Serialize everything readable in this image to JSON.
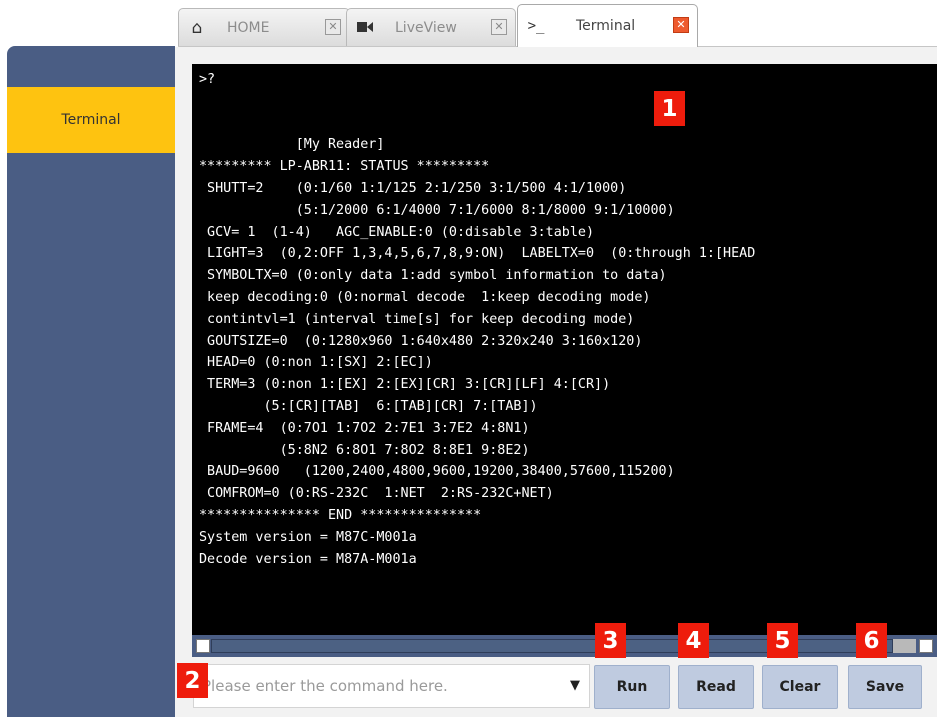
{
  "tabs": [
    {
      "label": "HOME",
      "icon": "home-icon"
    },
    {
      "label": "LiveView",
      "icon": "video-camera-icon"
    },
    {
      "label": "Terminal",
      "icon": "terminal-prompt-icon",
      "prompt_glyph": ">_",
      "active": true
    }
  ],
  "sidebar": {
    "items": [
      {
        "label": "Terminal",
        "active": true
      }
    ]
  },
  "terminal": {
    "lines": [
      ">?",
      "",
      "",
      "            [My Reader]",
      "********* LP-ABR11: STATUS *********",
      " SHUTT=2    (0:1/60 1:1/125 2:1/250 3:1/500 4:1/1000)",
      "            (5:1/2000 6:1/4000 7:1/6000 8:1/8000 9:1/10000)",
      " GCV= 1  (1-4)   AGC_ENABLE:0 (0:disable 3:table)",
      " LIGHT=3  (0,2:OFF 1,3,4,5,6,7,8,9:ON)  LABELTX=0  (0:through 1:[HEAD",
      " SYMBOLTX=0 (0:only data 1:add symbol information to data)",
      " keep decoding:0 (0:normal decode  1:keep decoding mode)",
      " contintvl=1 (interval time[s] for keep decoding mode)",
      " GOUTSIZE=0  (0:1280x960 1:640x480 2:320x240 3:160x120)",
      " HEAD=0 (0:non 1:[SX] 2:[EC])",
      " TERM=3 (0:non 1:[EX] 2:[EX][CR] 3:[CR][LF] 4:[CR])",
      "        (5:[CR][TAB]  6:[TAB][CR] 7:[TAB])",
      " FRAME=4  (0:7O1 1:7O2 2:7E1 3:7E2 4:8N1)",
      "          (5:8N2 6:8O1 7:8O2 8:8E1 9:8E2)",
      " BAUD=9600   (1200,2400,4800,9600,19200,38400,57600,115200)",
      " COMFROM=0 (0:RS-232C  1:NET  2:RS-232C+NET)",
      "*************** END ***************",
      "System version = M87C-M001a",
      "Decode version = M87A-M001a"
    ]
  },
  "command": {
    "placeholder": "Please enter the command here.",
    "dropdown_icon": "triangle-down-icon"
  },
  "buttons": {
    "run": "Run",
    "read": "Read",
    "clear": "Clear",
    "save": "Save"
  },
  "badges": [
    "1",
    "2",
    "3",
    "4",
    "5",
    "6"
  ],
  "colors": {
    "sidebar": "#4a5d84",
    "sidebar_active": "#fec310",
    "terminal_bg": "#000000",
    "button": "#bfcbe0",
    "badge": "#ee1c0c",
    "close_active": "#ee5a2e"
  }
}
